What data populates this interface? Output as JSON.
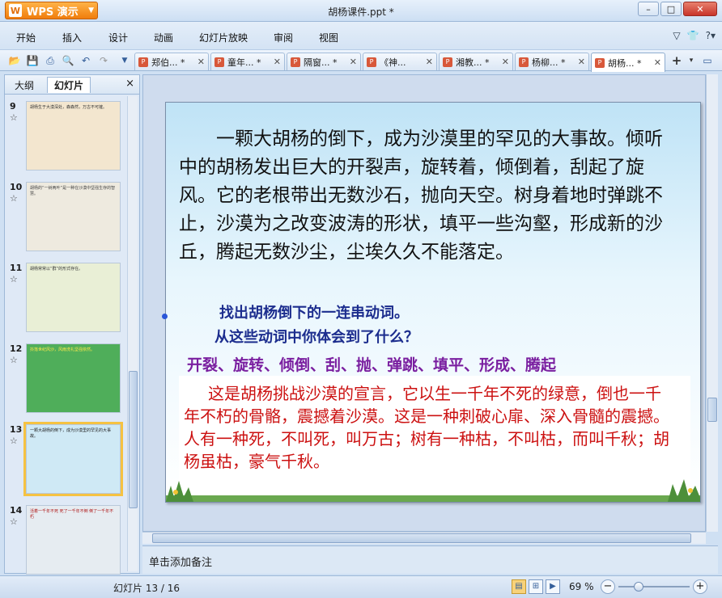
{
  "app": {
    "name": "WPS 演示",
    "logo_text": "W",
    "doc_title": "胡杨课件.ppt *"
  },
  "menu": [
    "开始",
    "插入",
    "设计",
    "动画",
    "幻灯片放映",
    "审阅",
    "视图"
  ],
  "toolbar_icons": [
    "open-icon",
    "save-icon",
    "print-icon",
    "preview-icon",
    "undo-icon",
    "redo-icon",
    "dropdown-icon"
  ],
  "tabs": [
    {
      "label": "郑伯... *",
      "active": false
    },
    {
      "label": "童年... *",
      "active": false
    },
    {
      "label": "隔窗... *",
      "active": false
    },
    {
      "label": "《神...",
      "active": false
    },
    {
      "label": "湘教... *",
      "active": false
    },
    {
      "label": "杨柳... *",
      "active": false
    },
    {
      "label": "胡杨... *",
      "active": true
    }
  ],
  "panel": {
    "tab_outline": "大纲",
    "tab_slides": "幻灯片",
    "close": "×",
    "thumbs": [
      {
        "num": "9",
        "star": "☆",
        "bg": "#f3e6cf",
        "text": "胡杨生于大漠深处，森森然，万古不可摧。",
        "selected": false
      },
      {
        "num": "10",
        "star": "☆",
        "bg": "#eeeadf",
        "text": "胡杨的“一树两叶”是一种在沙漠中坚强生存的智慧。",
        "selected": false
      },
      {
        "num": "11",
        "star": "☆",
        "bg": "#e9efd6",
        "text": "胡杨常常以“群”的形式存在。",
        "selected": false
      },
      {
        "num": "12",
        "star": "☆",
        "bg": "#4fae5a",
        "text": "抖落世纪风沙，风雨洗礼坚强依然。",
        "selected": false
      },
      {
        "num": "13",
        "star": "☆",
        "bg": "#cfe9f5",
        "text": "一颗大胡杨的倒下，成为沙漠里的罕见的大事故。",
        "selected": true
      },
      {
        "num": "14",
        "star": "☆",
        "bg": "#e6ecf1",
        "text": "活着一千年不死 死了一千年不倒 倒了一千年不朽",
        "selected": false
      }
    ]
  },
  "slide": {
    "main_text": "一颗大胡杨的倒下，成为沙漠里的罕见的大事故。倾听中的胡杨发出巨大的开裂声，旋转着，倾倒着，刮起了旋风。它的老根带出无数沙石，抛向天空。树身着地时弹跳不止，沙漠为之改变波涛的形状，填平一些沟壑，形成新的沙丘，腾起无数沙尘，尘埃久久不能落定。",
    "question1": "找出胡杨倒下的一连串动词。",
    "question2": "从这些动词中你体会到了什么？",
    "verbs": "开裂、旋转、倾倒、刮、抛、弹跳、填平、形成、腾起",
    "answer": "这是胡杨挑战沙漠的宣言，它以生一千年不死的绿意，倒也一千年不朽的骨骼，震撼着沙漠。这是一种刺破心扉、深入骨髓的震撼。人有一种死，不叫死，叫万古；树有一种枯，不叫枯，而叫千秋；胡杨虽枯，豪气千秋。"
  },
  "notes_placeholder": "单击添加备注",
  "status": {
    "slide_counter": "幻灯片 13 / 16",
    "zoom": "69 %"
  },
  "colors": {
    "accent": "#f07d0c",
    "slide_text": "#111111",
    "question": "#1c2d8e",
    "verbs": "#7a1fa0",
    "answer": "#cc1111"
  }
}
